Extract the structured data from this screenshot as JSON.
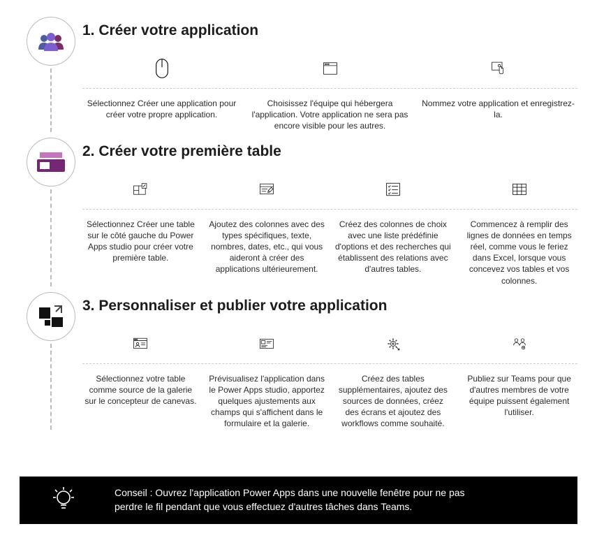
{
  "sections": [
    {
      "title": "1. Créer votre application",
      "steps": [
        {
          "text": "Sélectionnez Créer une application pour créer votre propre application."
        },
        {
          "text": "Choisissez l'équipe qui hébergera l'application. Votre application ne sera pas encore visible pour les autres."
        },
        {
          "text": "Nommez votre application et enregistrez-la."
        }
      ]
    },
    {
      "title": "2. Créer votre première table",
      "steps": [
        {
          "text": "Sélectionnez Créer une table sur le côté gauche du Power Apps studio pour créer votre première table."
        },
        {
          "text": "Ajoutez des colonnes avec des types spécifiques, texte, nombres, dates, etc., qui vous aideront à créer des applications ultérieurement."
        },
        {
          "text": "Créez des colonnes de choix avec une liste prédéfinie d'options et des recherches qui établissent des relations avec d'autres tables."
        },
        {
          "text": "Commencez à remplir des lignes de données en temps réel, comme vous le feriez dans Excel, lorsque vous concevez vos tables et vos colonnes."
        }
      ]
    },
    {
      "title": "3. Personnaliser et publier votre application",
      "steps": [
        {
          "text": "Sélectionnez votre table comme source de la galerie sur le concepteur de canevas."
        },
        {
          "text": "Prévisualisez l'application dans le Power Apps studio, apportez quelques ajustements aux champs qui s'affichent dans le formulaire et la galerie."
        },
        {
          "text": "Créez des tables supplémentaires, ajoutez des sources de données, créez des écrans et ajoutez des workflows comme souhaité."
        },
        {
          "text": "Publiez sur Teams pour que d'autres membres de votre équipe puissent également l'utiliser."
        }
      ]
    }
  ],
  "tip": "Conseil : Ouvrez l'application Power Apps dans une nouvelle fenêtre pour ne pas perdre le fil pendant que vous effectuez d'autres tâches dans Teams."
}
